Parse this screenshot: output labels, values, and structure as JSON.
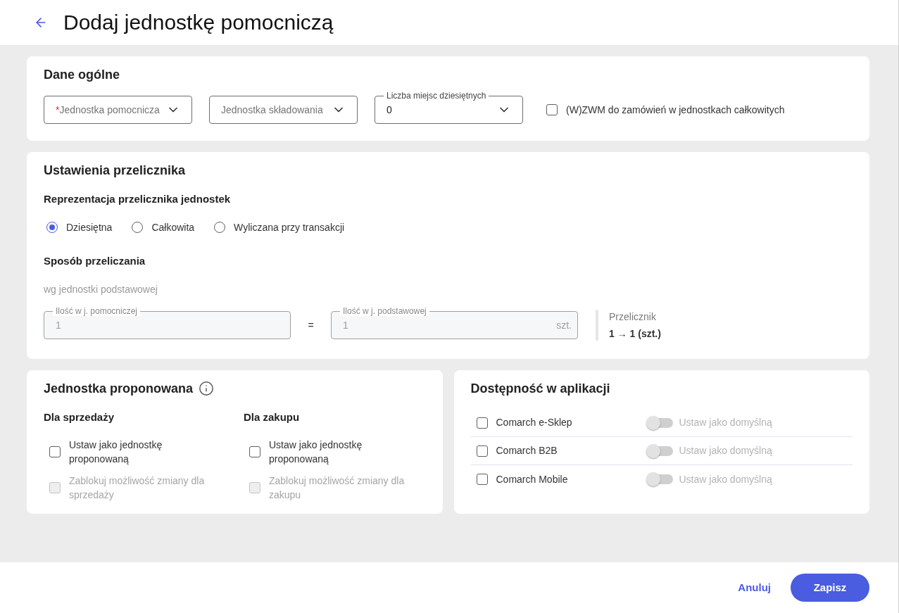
{
  "header": {
    "title": "Dodaj jednostkę pomocniczą"
  },
  "general": {
    "title": "Dane ogólne",
    "fields": [
      {
        "kind": "select",
        "required_mark": "*",
        "placeholder": "Jednostka pomocnicza"
      },
      {
        "kind": "select",
        "placeholder": "Jednostka składowania"
      },
      {
        "kind": "select",
        "label": "Liczba miejsc dziesiętnych",
        "value": "0"
      }
    ],
    "option": {
      "label": "(W)ZWM do zamówień w jednostkach całkowitych",
      "checked": false
    }
  },
  "converter": {
    "title": "Ustawienia przelicznika",
    "representation": {
      "title": "Reprezentacja przelicznika jednostek",
      "options": [
        {
          "label": "Dziesiętna",
          "selected": true
        },
        {
          "label": "Całkowita",
          "selected": false
        },
        {
          "label": "Wyliczana przy transakcji",
          "selected": false
        }
      ]
    },
    "method": {
      "title": "Sposób przeliczania",
      "basis": "wg jednostki podstawowej",
      "inputs": [
        {
          "label": "Ilość w j. pomocniczej",
          "value": "1",
          "disabled": true
        },
        {
          "label": "Ilość w j. podstawowej",
          "value": "1",
          "suffix": "szt.",
          "disabled": true
        }
      ],
      "operator": "=",
      "result": {
        "label": "Przelicznik",
        "value": "1 → 1 (szt.)"
      }
    }
  },
  "proposed": {
    "title": "Jednostka proponowana",
    "groups": [
      {
        "title": "Dla sprzedaży",
        "options": [
          {
            "label": "Ustaw jako jednostkę proponowaną",
            "checked": false,
            "disabled": false
          },
          {
            "label": "Zablokuj możliwość zmiany dla sprzedaży",
            "checked": false,
            "disabled": true
          }
        ]
      },
      {
        "title": "Dla zakupu",
        "options": [
          {
            "label": "Ustaw jako jednostkę proponowaną",
            "checked": false,
            "disabled": false
          },
          {
            "label": "Zablokuj możliwość zmiany dla zakupu",
            "checked": false,
            "disabled": true
          }
        ]
      }
    ]
  },
  "availability": {
    "title": "Dostępność w aplikacji",
    "apps": [
      {
        "name": "Comarch e-Sklep",
        "checked": false,
        "default": {
          "label": "Ustaw jako domyślną",
          "on": false,
          "disabled": true
        }
      },
      {
        "name": "Comarch B2B",
        "checked": false,
        "default": {
          "label": "Ustaw jako domyślną",
          "on": false,
          "disabled": true
        }
      },
      {
        "name": "Comarch Mobile",
        "checked": false,
        "default": {
          "label": "Ustaw jako domyślną",
          "on": false,
          "disabled": true
        }
      }
    ]
  },
  "footer": {
    "buttons": [
      {
        "kind": "link",
        "label": "Anuluj"
      },
      {
        "kind": "primary",
        "label": "Zapisz"
      }
    ]
  }
}
